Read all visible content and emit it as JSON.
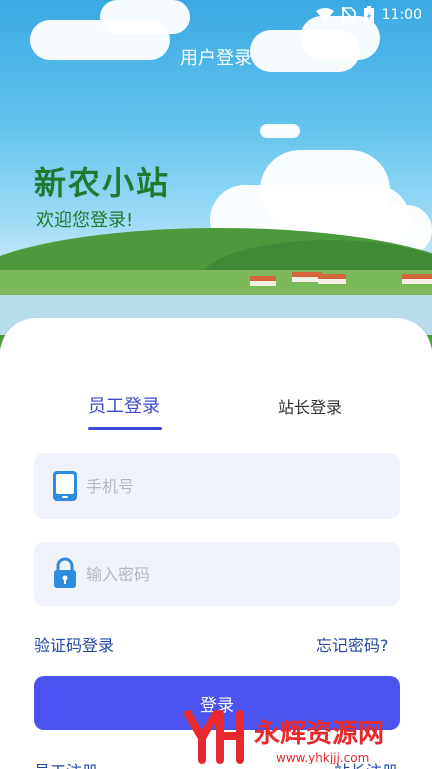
{
  "statusbar": {
    "time": "11:00",
    "icons": [
      "wifi-icon",
      "no-sim-icon",
      "battery-charging-icon"
    ]
  },
  "header": {
    "title": "用户登录"
  },
  "brand": {
    "name": "新农小站",
    "welcome": "欢迎您登录!"
  },
  "tabs": [
    {
      "label": "员工登录",
      "active": true
    },
    {
      "label": "站长登录",
      "active": false
    }
  ],
  "form": {
    "phone": {
      "placeholder": "手机号",
      "value": "",
      "icon": "phone-icon"
    },
    "password": {
      "placeholder": "输入密码",
      "value": "",
      "icon": "lock-icon"
    },
    "sms_login_label": "验证码登录",
    "forgot_password_label": "忘记密码?",
    "login_label": "登录",
    "employee_register_label": "员工注册",
    "station_register_label": "站长注册"
  },
  "watermark": {
    "text": "永辉资源网",
    "url": "www.yhkjjj.com"
  },
  "colors": {
    "accent": "#4a52ef",
    "tab_active": "#3b48d8",
    "brand": "#1e7a2e",
    "link": "#2448a8"
  }
}
